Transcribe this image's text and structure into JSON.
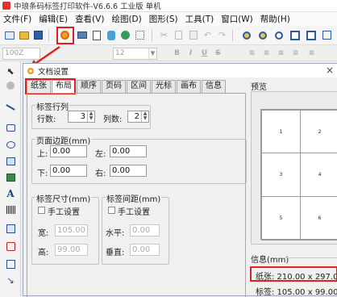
{
  "app": {
    "title": "中琅条码标签打印软件-V6.6.6 工业版 单机"
  },
  "menu": [
    "文件(F)",
    "编辑(E)",
    "查看(V)",
    "绘图(D)",
    "图形(S)",
    "工具(T)",
    "窗口(W)",
    "帮助(H)"
  ],
  "formatbar": {
    "zoom": "100Z",
    "font_size": "12",
    "bold": "B",
    "italic": "I",
    "underline": "U",
    "strike": "S"
  },
  "dialog": {
    "title": "文档设置",
    "close": "×",
    "tabs": [
      "纸张",
      "布局",
      "顺序",
      "页码",
      "区间",
      "光标",
      "画布",
      "信息"
    ],
    "active_tab": 1,
    "layout": {
      "rows_group": "标签行列",
      "rows_label": "行数:",
      "rows_value": "3",
      "cols_label": "列数:",
      "cols_value": "2",
      "margin_group": "页面边距(mm)",
      "top_label": "上:",
      "top_value": "0.00",
      "left_label": "左:",
      "left_value": "0.00",
      "bottom_label": "下:",
      "bottom_value": "0.00",
      "right_label": "右:",
      "right_value": "0.00",
      "size_group": "标签尺寸(mm)",
      "size_manual": "手工设置",
      "width_label": "宽:",
      "width_value": "105.00",
      "height_label": "高:",
      "height_value": "99.00",
      "gap_group": "标签间距(mm)",
      "gap_manual": "手工设置",
      "hgap_label": "水平:",
      "hgap_value": "0.00",
      "vgap_label": "垂直:",
      "vgap_value": "0.00"
    },
    "preview": {
      "label": "预览",
      "cells": [
        "1",
        "2",
        "3",
        "4",
        "5",
        "6"
      ]
    },
    "info": {
      "label": "信息(mm)",
      "paper": "纸张: 210.00 x 297.00",
      "label_size": "标签: 105.00 x 99.00"
    }
  },
  "colors": {
    "highlight": "#e02020",
    "arrow": "#e02020"
  }
}
